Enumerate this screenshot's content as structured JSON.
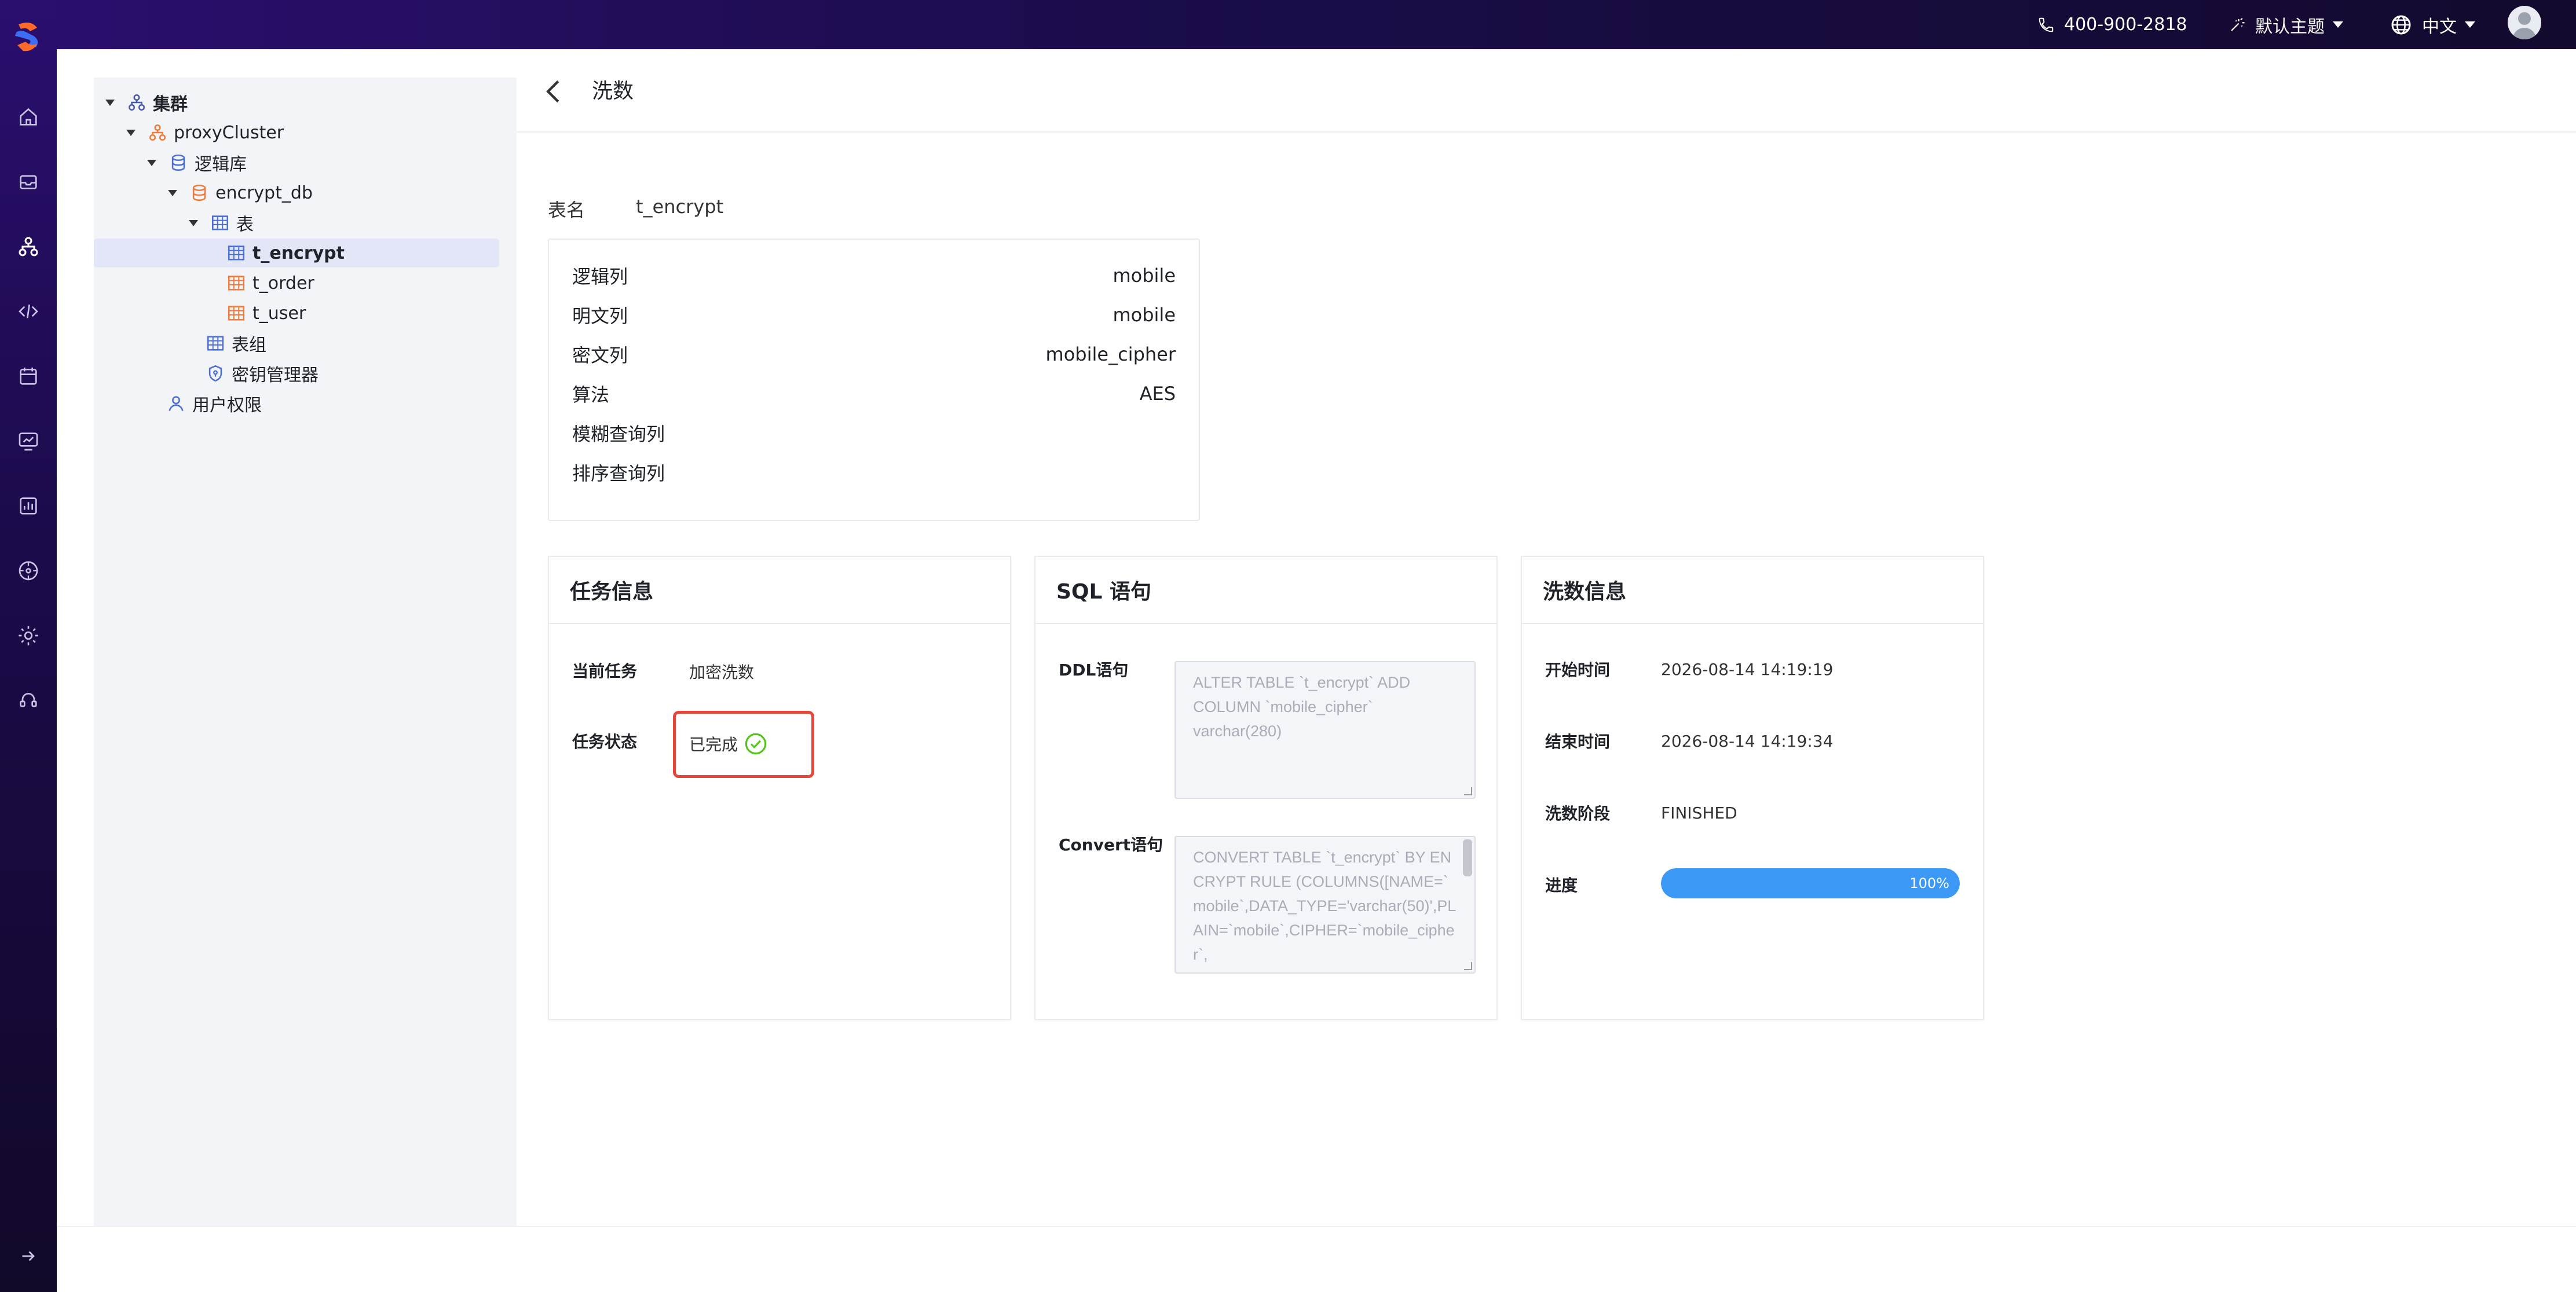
{
  "topbar": {
    "phone": "400-900-2818",
    "theme_label": "默认主题",
    "language_label": "中文"
  },
  "tree": {
    "root": "集群",
    "cluster": "proxyCluster",
    "logic_db": "逻辑库",
    "database": "encrypt_db",
    "tables_group": "表",
    "tables": [
      "t_encrypt",
      "t_order",
      "t_user"
    ],
    "table_group": "表组",
    "key_manager": "密钥管理器",
    "user_perm": "用户权限"
  },
  "header": {
    "title": "洗数"
  },
  "table_info": {
    "label": "表名",
    "value": "t_encrypt",
    "rows": [
      {
        "key": "逻辑列",
        "value": "mobile"
      },
      {
        "key": "明文列",
        "value": "mobile"
      },
      {
        "key": "密文列",
        "value": "mobile_cipher"
      },
      {
        "key": "算法",
        "value": "AES"
      },
      {
        "key": "模糊查询列",
        "value": ""
      },
      {
        "key": "排序查询列",
        "value": ""
      }
    ]
  },
  "task_panel": {
    "title": "任务信息",
    "current_task_label": "当前任务",
    "current_task_value": "加密洗数",
    "status_label": "任务状态",
    "status_value": "已完成",
    "status_color": "#52c41a"
  },
  "sql_panel": {
    "title": "SQL 语句",
    "ddl_label": "DDL语句",
    "ddl_text": "ALTER TABLE `t_encrypt` ADD COLUMN `mobile_cipher` varchar(280)",
    "convert_label": "Convert语句",
    "convert_text": "CONVERT TABLE `t_encrypt` BY ENCRYPT RULE (COLUMNS([NAME=`mobile`,DATA_TYPE='varchar(50)',PLAIN=`mobile`,CIPHER=`mobile_cipher`,"
  },
  "wash_panel": {
    "title": "洗数信息",
    "start_label": "开始时间",
    "start_value": "2026-08-14 14:19:19",
    "end_label": "结束时间",
    "end_value": "2026-08-14 14:19:34",
    "stage_label": "洗数阶段",
    "stage_value": "FINISHED",
    "progress_label": "进度",
    "progress_text": "100%",
    "progress_value": 1.0
  },
  "colors": {
    "accent": "#3c98f5",
    "highlight": "#e5483b",
    "nav_bg": "#1c0b4c"
  }
}
